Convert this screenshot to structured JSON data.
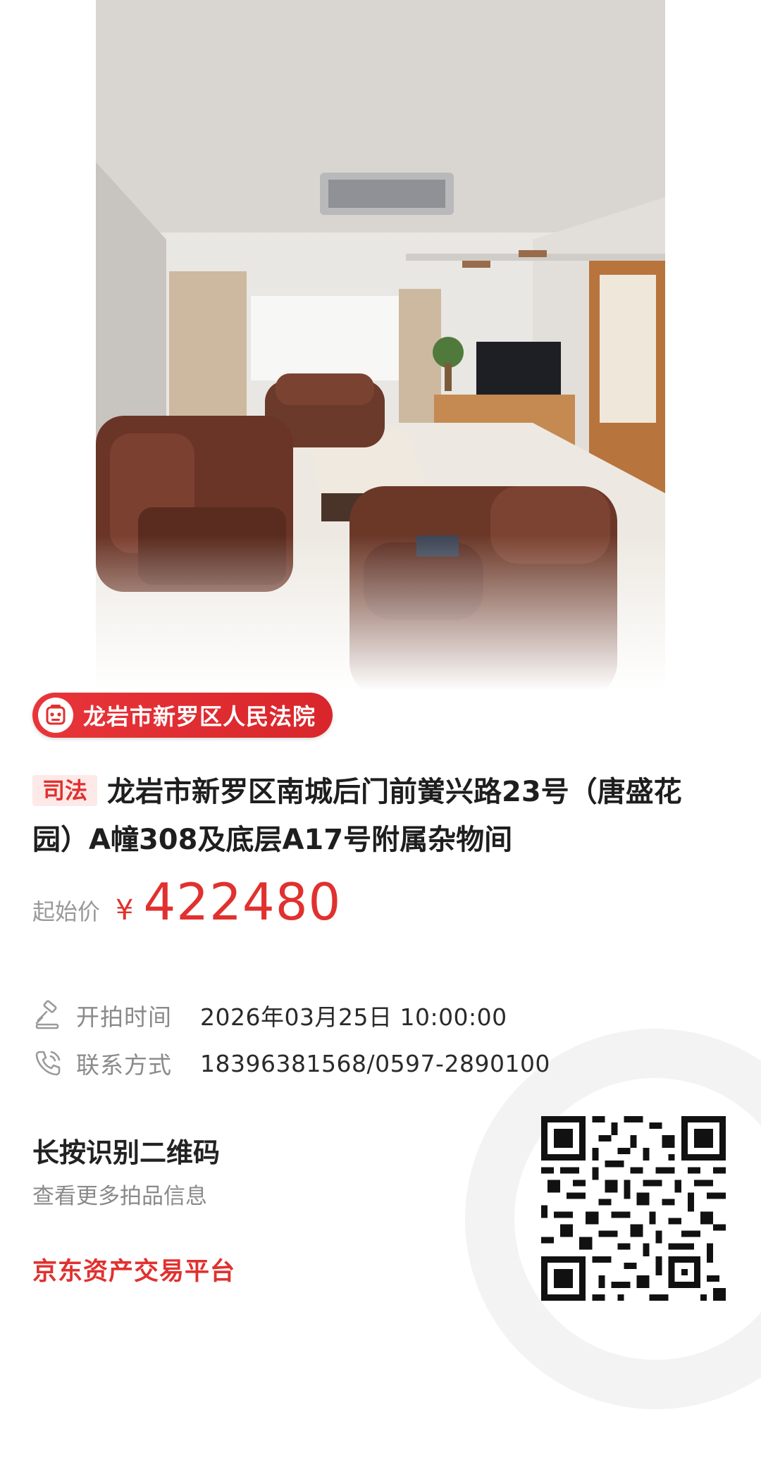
{
  "court": {
    "name": "龙岩市新罗区人民法院",
    "icon": "court-seal-icon"
  },
  "listing": {
    "tag": "司法",
    "title": "龙岩市新罗区南城后门前黉兴路23号（唐盛花园）A幢308及底层A17号附属杂物间"
  },
  "price": {
    "label": "起始价",
    "currency": "¥",
    "value": "422480"
  },
  "info": {
    "start_time": {
      "label": "开拍时间",
      "value": "2026年03月25日 10:00:00",
      "icon": "auction-gavel-icon"
    },
    "contact": {
      "label": "联系方式",
      "value": "18396381568/0597-2890100",
      "icon": "phone-icon"
    }
  },
  "footer": {
    "qr_title": "长按识别二维码",
    "qr_subtitle": "查看更多拍品信息",
    "platform": "京东资产交易平台"
  },
  "colors": {
    "accent": "#e0312f",
    "tag_bg": "#fde9e8"
  }
}
